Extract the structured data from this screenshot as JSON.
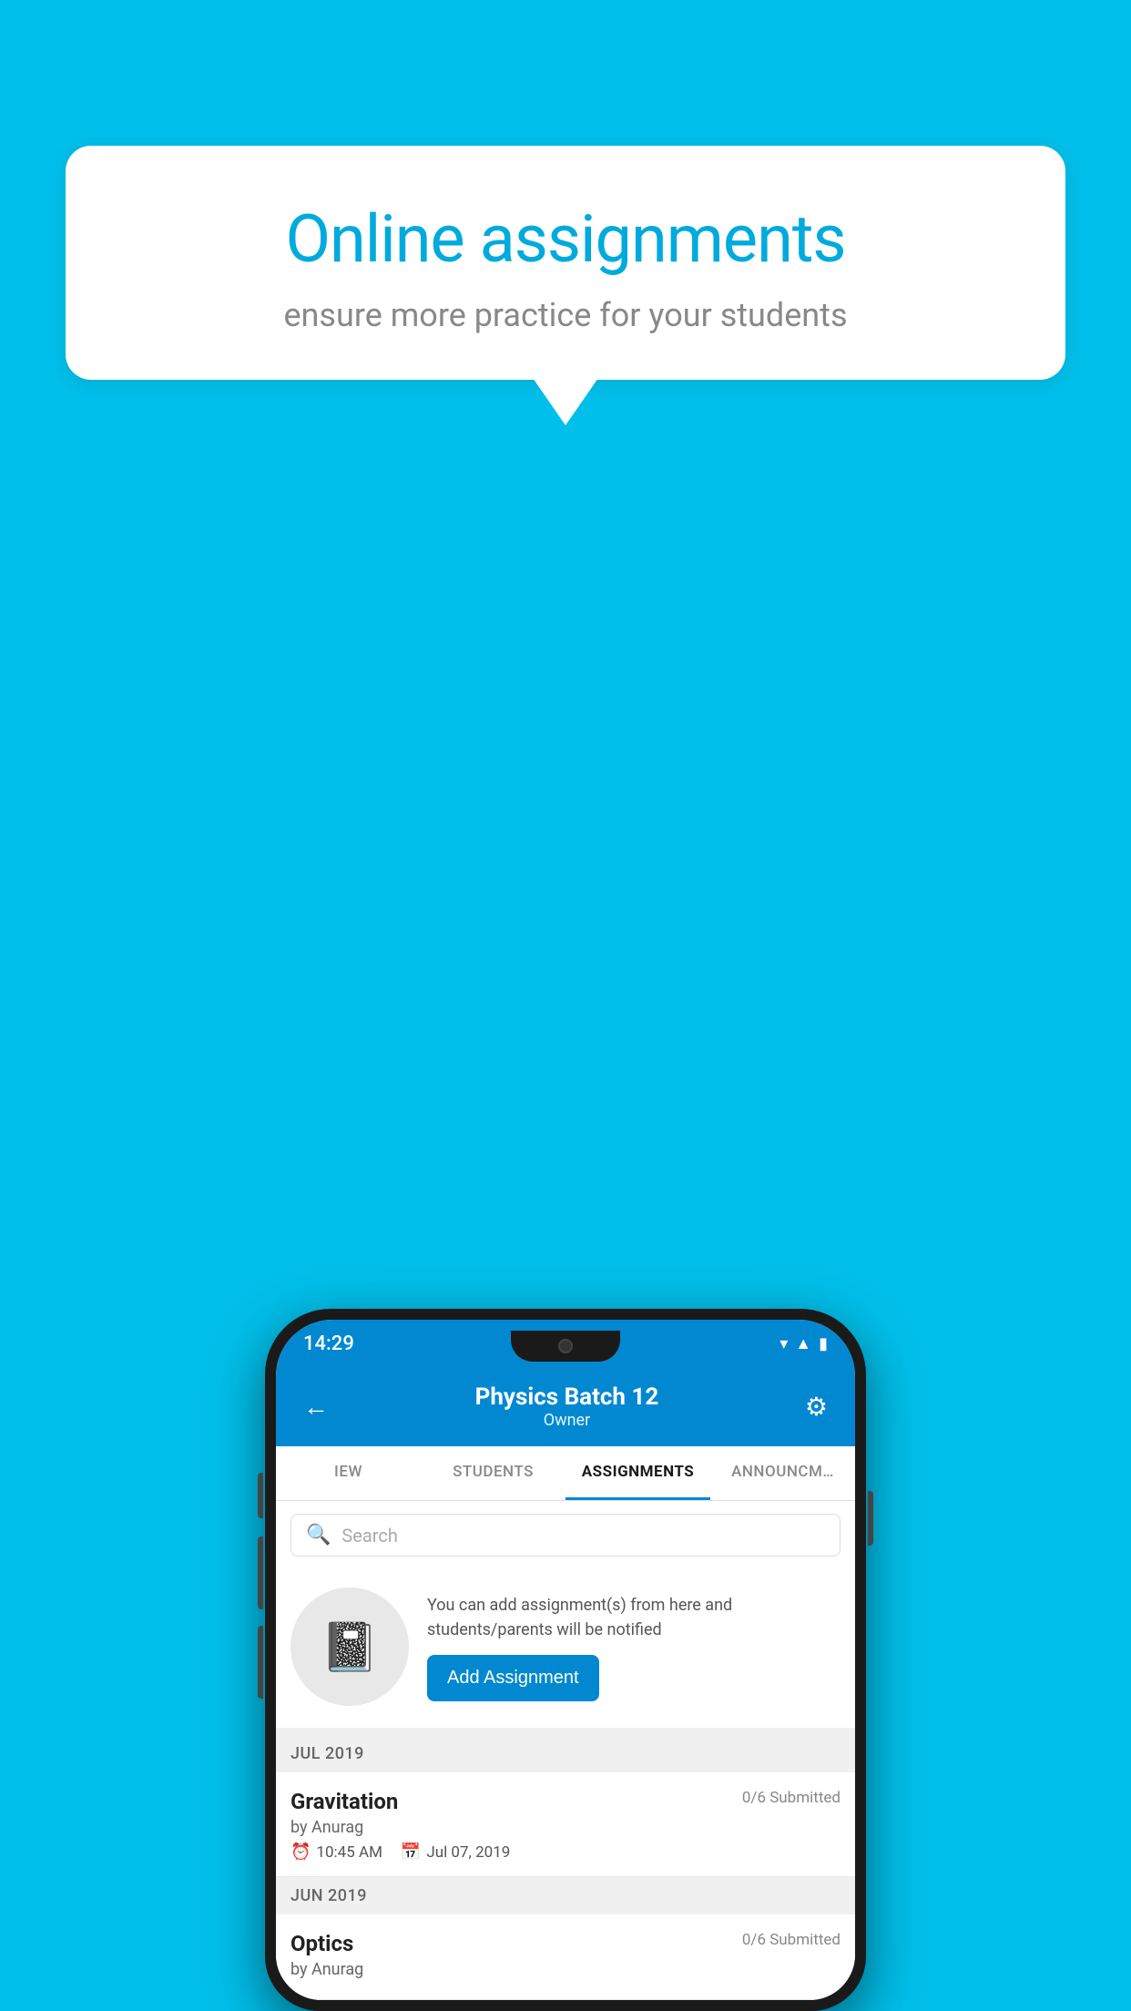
{
  "background": {
    "color": "#00BFEA"
  },
  "speech_bubble": {
    "title": "Online assignments",
    "subtitle": "ensure more practice for your students"
  },
  "phone": {
    "status_bar": {
      "time": "14:29",
      "icons": [
        "wifi",
        "signal",
        "battery"
      ]
    },
    "header": {
      "title": "Physics Batch 12",
      "subtitle": "Owner",
      "back_label": "←",
      "gear_label": "⚙"
    },
    "tabs": [
      {
        "label": "IEW",
        "active": false
      },
      {
        "label": "STUDENTS",
        "active": false
      },
      {
        "label": "ASSIGNMENTS",
        "active": true
      },
      {
        "label": "ANNOUNCEM…",
        "active": false
      }
    ],
    "search": {
      "placeholder": "Search"
    },
    "promo": {
      "description": "You can add assignment(s) from here and students/parents will be notified",
      "button_label": "Add Assignment"
    },
    "sections": [
      {
        "month": "JUL 2019",
        "assignments": [
          {
            "name": "Gravitation",
            "submitted": "0/6 Submitted",
            "by": "by Anurag",
            "time": "10:45 AM",
            "date": "Jul 07, 2019"
          }
        ]
      },
      {
        "month": "JUN 2019",
        "assignments": [
          {
            "name": "Optics",
            "submitted": "0/6 Submitted",
            "by": "by Anurag",
            "time": "",
            "date": ""
          }
        ]
      }
    ]
  }
}
